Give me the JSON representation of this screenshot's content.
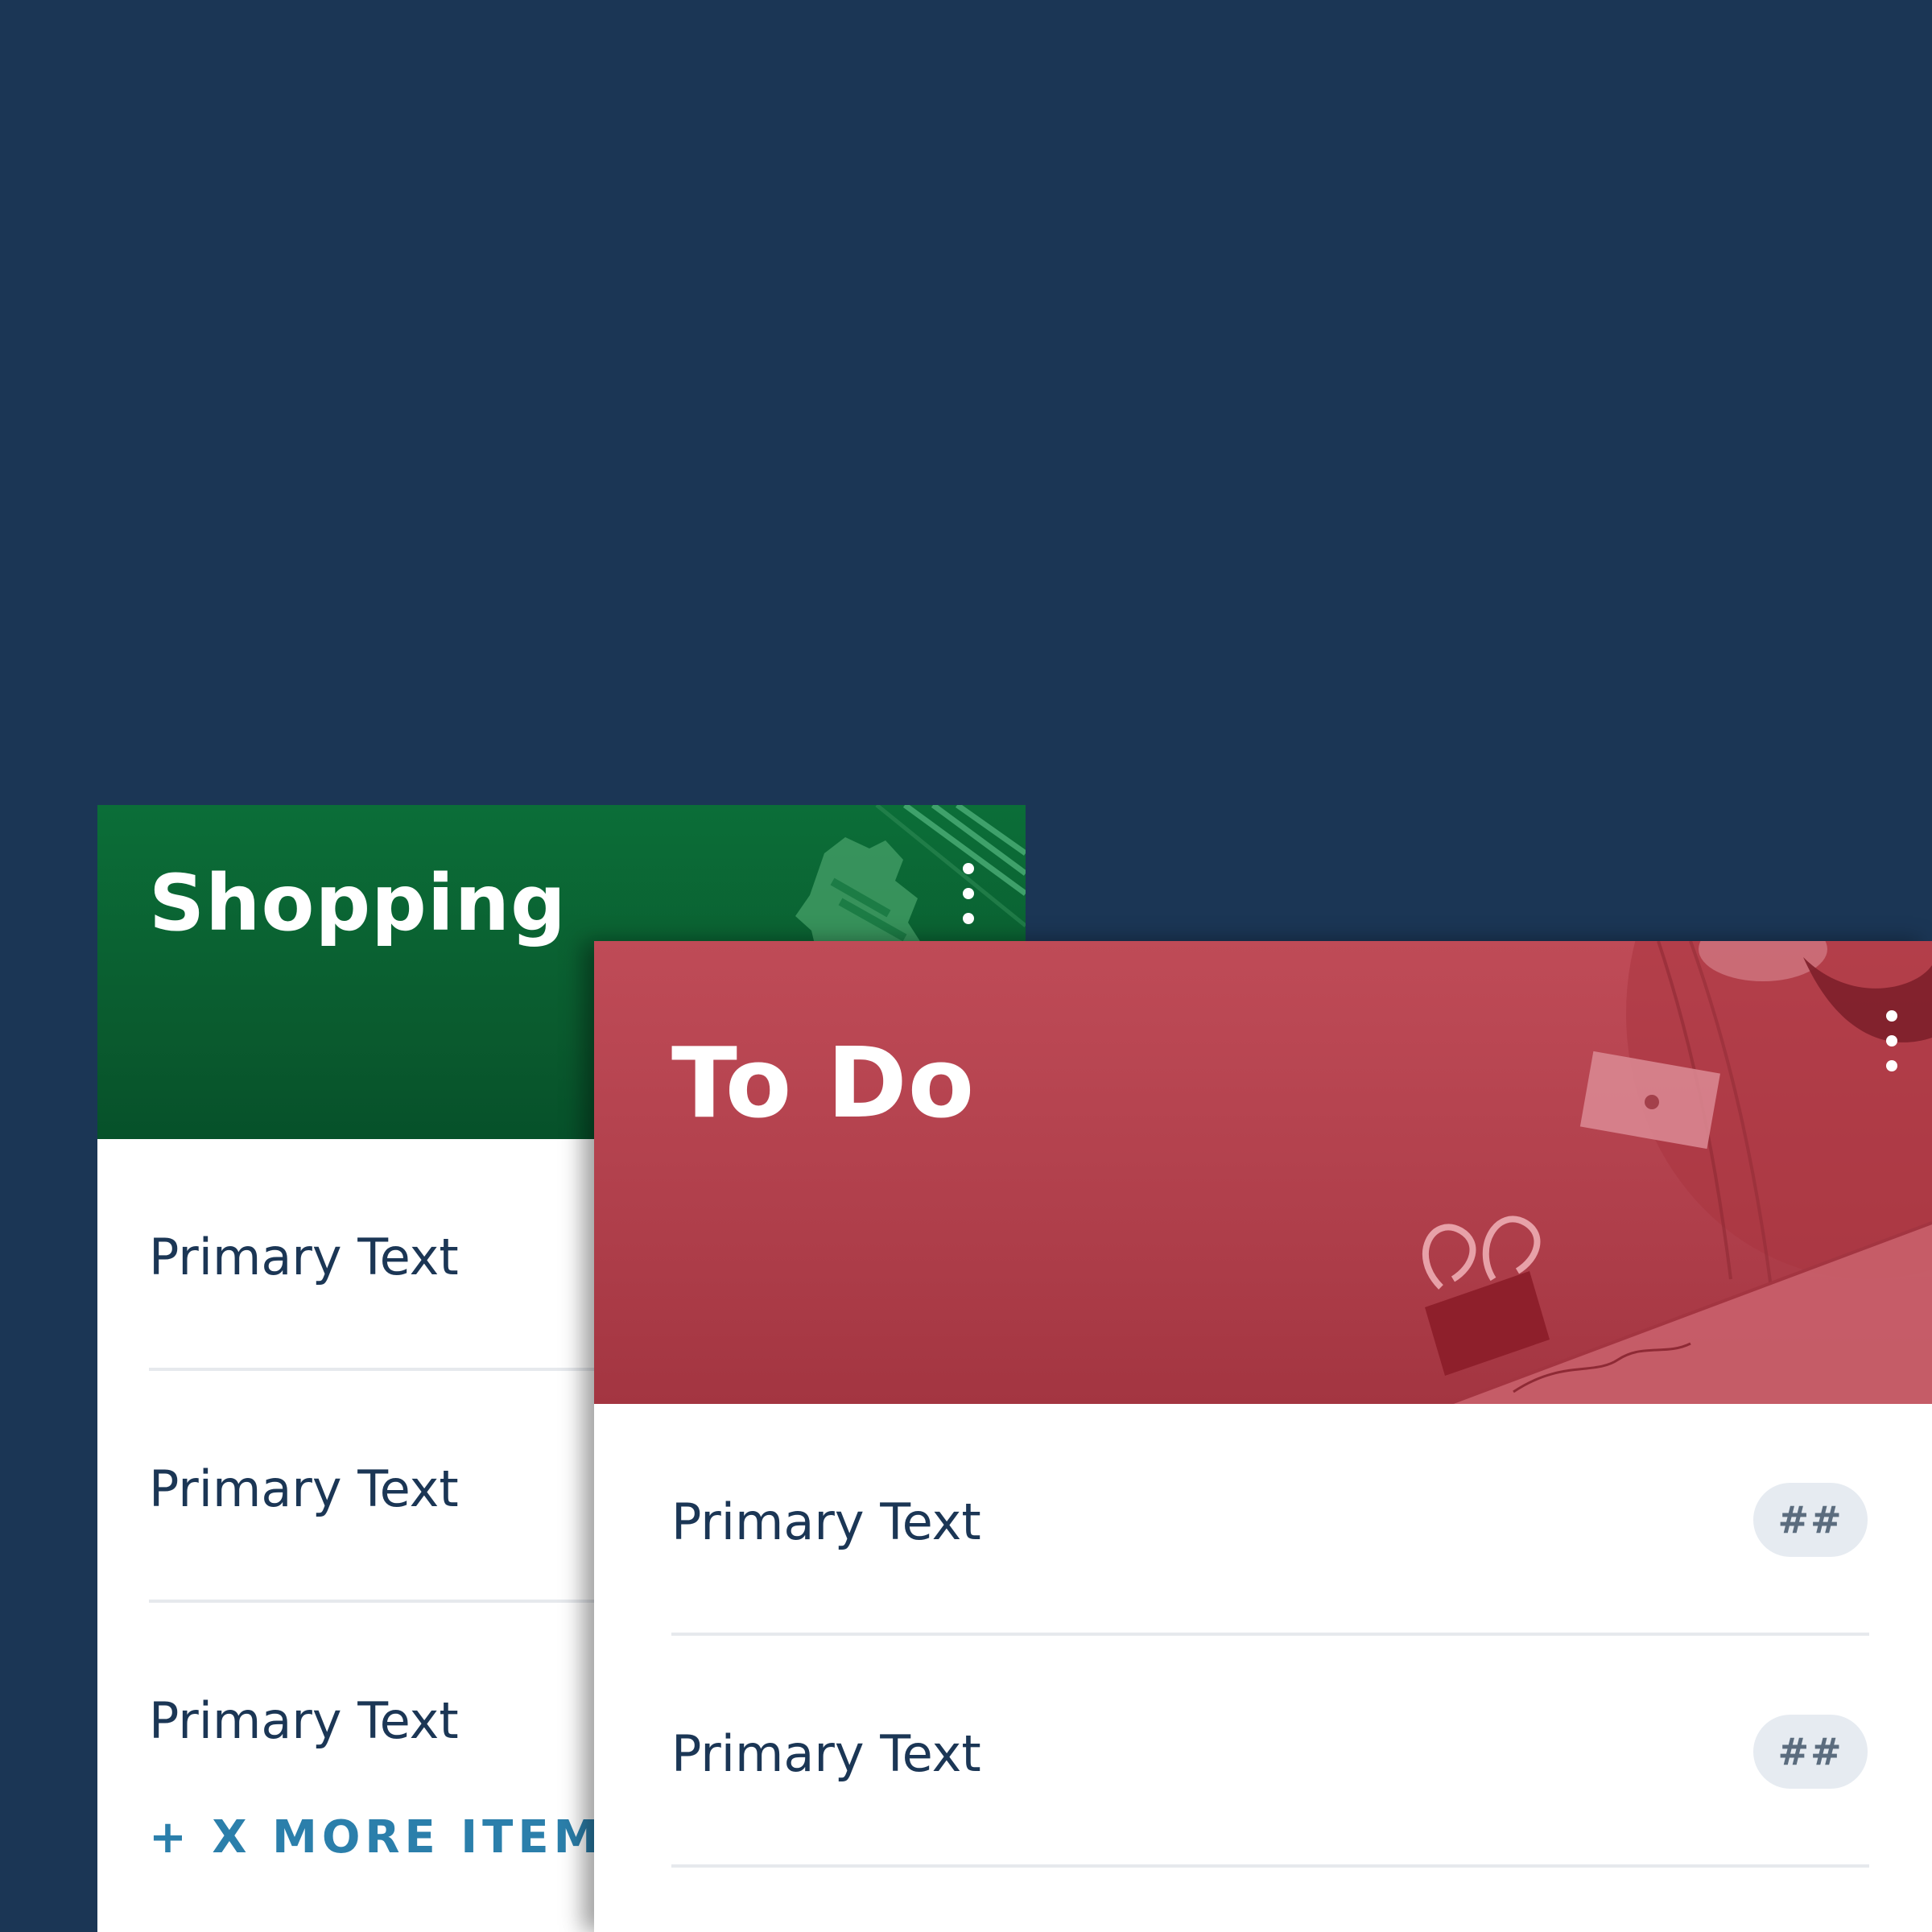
{
  "colors": {
    "background": "#1b3655",
    "shopping_header": "#0b6e38",
    "todo_header": "#b1404c",
    "primary_text": "#1b3655",
    "link_text": "#2b7fab",
    "badge_bg": "#e6ebf1"
  },
  "shopping_card": {
    "title": "Shopping",
    "menu_icon": "more-vertical-icon",
    "items": [
      {
        "primary": "Primary Text"
      },
      {
        "primary": "Primary Text"
      },
      {
        "primary": "Primary Text"
      }
    ],
    "more_items_label": "+ X MORE ITEMS"
  },
  "todo_card": {
    "title": "To Do",
    "menu_icon": "more-vertical-icon",
    "items": [
      {
        "primary": "Primary Text",
        "badge": "##"
      },
      {
        "primary": "Primary Text",
        "badge": "##"
      }
    ]
  }
}
